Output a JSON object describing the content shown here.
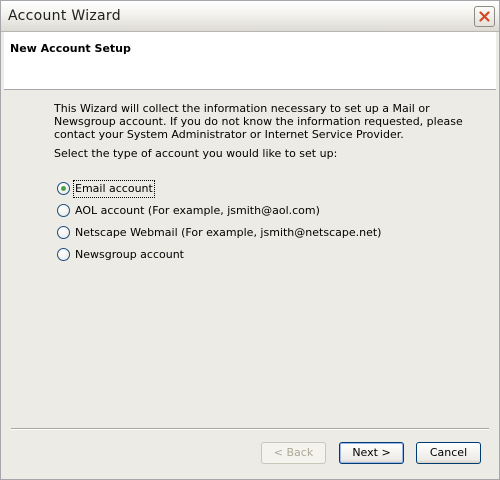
{
  "window": {
    "title": "Account Wizard"
  },
  "header": {
    "title": "New Account Setup"
  },
  "content": {
    "intro": "This Wizard will collect the information necessary to set up a Mail or Newsgroup account. If you do not know the information requested, please contact your System Administrator or Internet Service Provider.",
    "prompt": "Select the type of account you would like to set up:"
  },
  "account_types": [
    {
      "label": "Email account",
      "selected": true
    },
    {
      "label": "AOL account (For example, jsmith@aol.com)",
      "selected": false
    },
    {
      "label": "Netscape Webmail (For example, jsmith@netscape.net)",
      "selected": false
    },
    {
      "label": "Newsgroup account",
      "selected": false
    }
  ],
  "buttons": {
    "back": "< Back",
    "next": "Next >",
    "cancel": "Cancel"
  },
  "icons": {
    "close": "close-icon"
  },
  "colors": {
    "close_x": "#d24a24",
    "radio_selected": "#4da04a"
  }
}
